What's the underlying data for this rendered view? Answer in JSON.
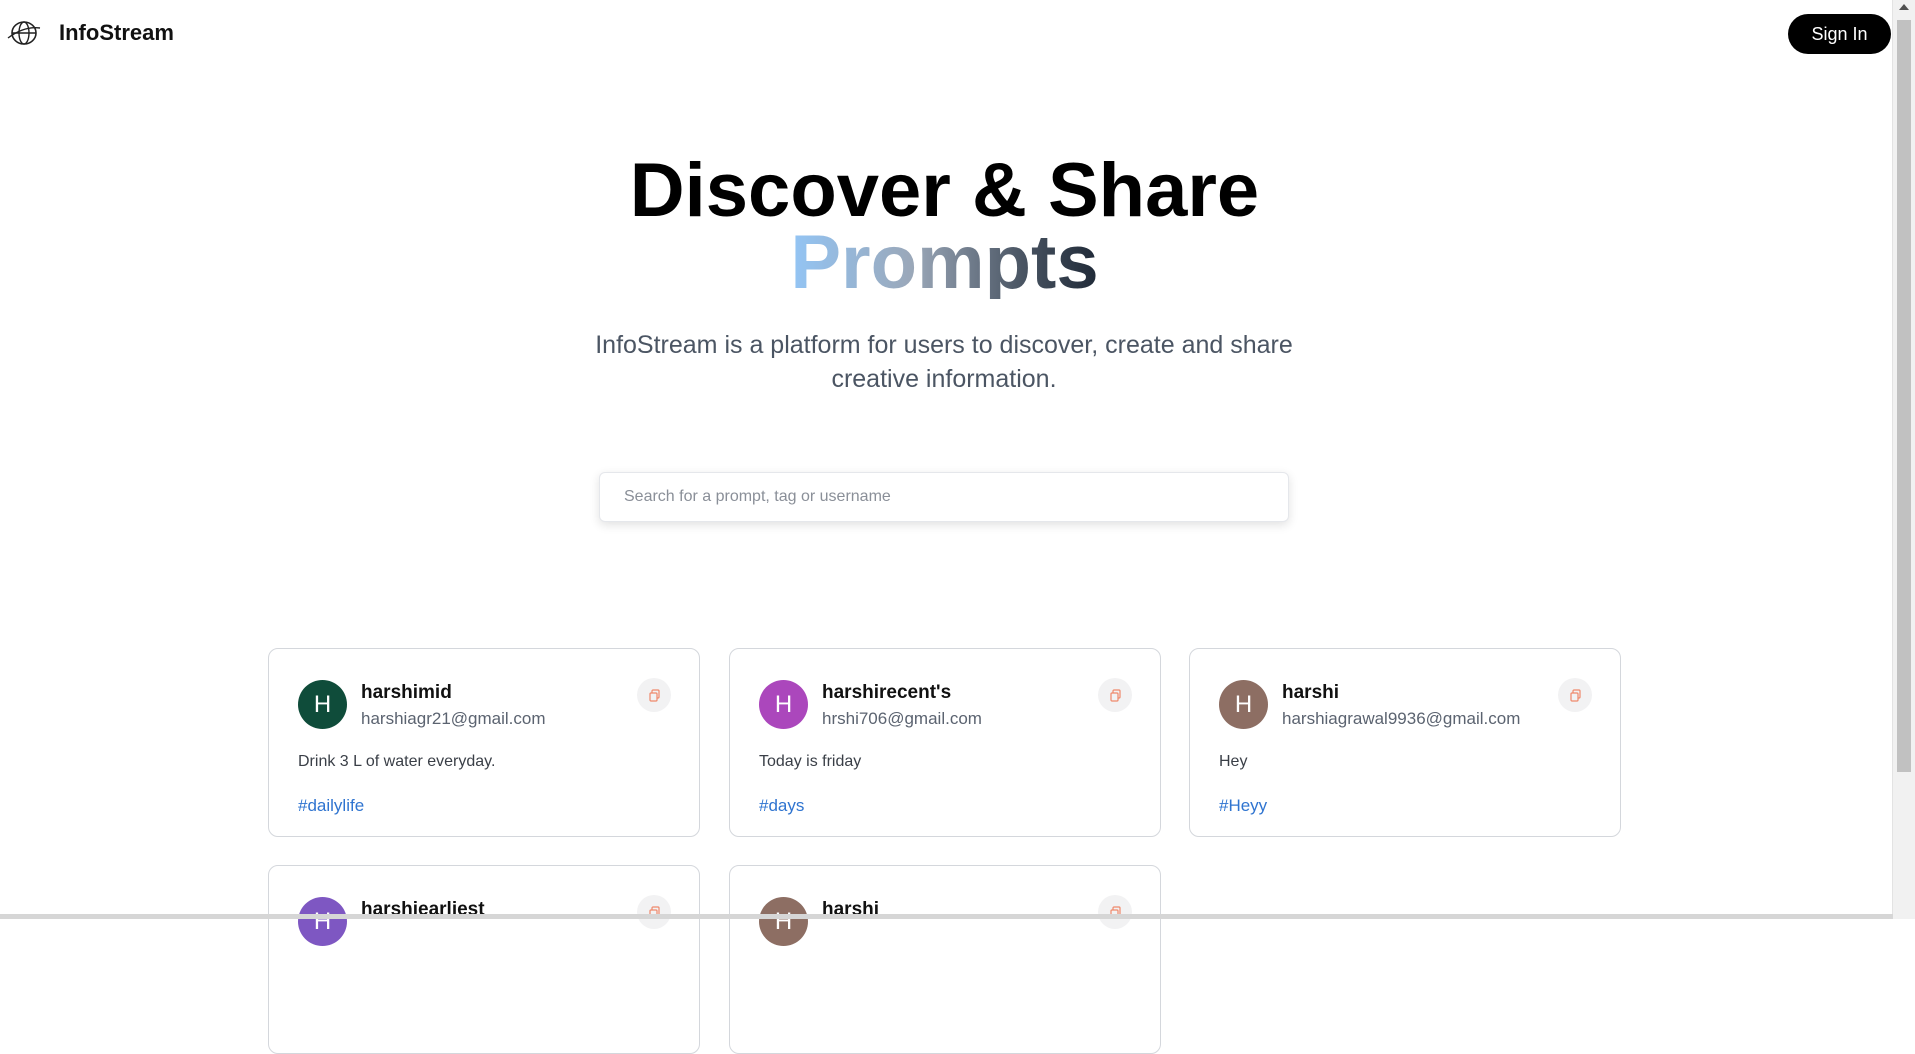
{
  "nav": {
    "brand": "InfoStream",
    "sign_in_label": "Sign In",
    "logo_icon": "globe-icon"
  },
  "hero": {
    "title_line1": "Discover & Share",
    "title_line2": "Prompts",
    "description": "InfoStream is a platform for users to discover, create and share creative information."
  },
  "search": {
    "placeholder": "Search for a prompt, tag or username",
    "value": ""
  },
  "colors": {
    "accent_tag": "#2f74d0",
    "button_bg": "#000000",
    "copy_icon": "#f0896b"
  },
  "cards": [
    {
      "initial": "H",
      "avatar_color": "#0f4c3a",
      "username": "harshimid",
      "email": "harshiagr21@gmail.com",
      "prompt": "Drink 3 L of water everyday.",
      "tag": "#dailylife",
      "copy_icon": "copy-icon"
    },
    {
      "initial": "H",
      "avatar_color": "#ab47bc",
      "username": "harshirecent's",
      "email": "hrshi706@gmail.com",
      "prompt": "Today is friday",
      "tag": "#days",
      "copy_icon": "copy-icon"
    },
    {
      "initial": "H",
      "avatar_color": "#8d6e63",
      "username": "harshi",
      "email": "harshiagrawal9936@gmail.com",
      "prompt": "Hey",
      "tag": "#Heyy",
      "copy_icon": "copy-icon"
    },
    {
      "initial": "H",
      "avatar_color": "#7e57c2",
      "username": "harshiearliest",
      "email": "",
      "prompt": "",
      "tag": "",
      "copy_icon": "copy-icon"
    },
    {
      "initial": "H",
      "avatar_color": "#8d6e63",
      "username": "harshi",
      "email": "",
      "prompt": "",
      "tag": "",
      "copy_icon": "copy-icon"
    }
  ]
}
